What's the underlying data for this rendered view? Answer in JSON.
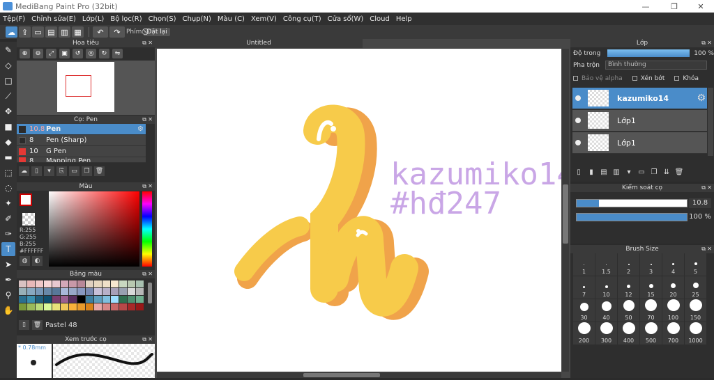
{
  "window": {
    "title": "MediBang Paint Pro (32bit)",
    "minimize": "—",
    "maximize": "❐",
    "close": "✕"
  },
  "menu": [
    "Tệp(F)",
    "Chỉnh sửa(E)",
    "Lớp(L)",
    "Bộ lọc(R)",
    "Chọn(S)",
    "Chụp(N)",
    "Màu (C)",
    "Xem(V)",
    "Công cụ(T)",
    "Cửa sổ(W)",
    "Cloud",
    "Help"
  ],
  "toolbar": {
    "shortcut_label": "Phím",
    "reset_label": "Đặt lại"
  },
  "navigator": {
    "title": "Hoa tiêu"
  },
  "brush": {
    "title": "Cọ: Pen",
    "items": [
      {
        "size": "10.8",
        "name": "Pen",
        "color": "#2b2b2b"
      },
      {
        "size": "8",
        "name": "Pen (Sharp)",
        "color": "#2b2b2b"
      },
      {
        "size": "10",
        "name": "G Pen",
        "color": "#e53935"
      },
      {
        "size": "8",
        "name": "Mapping Pen",
        "color": "#e53935"
      }
    ]
  },
  "color": {
    "title": "Màu",
    "r": "R:255",
    "g": "G:255",
    "b": "B:255",
    "hex": "#FFFFFF"
  },
  "palette": {
    "title": "Bảng màu",
    "name": "Pastel 48",
    "swatches": [
      "#d9c2c2",
      "#e8b8b8",
      "#f0c8c8",
      "#f7d6d6",
      "#e8c8d0",
      "#d4a8b8",
      "#c898a8",
      "#b88898",
      "#e0d0c0",
      "#e8d8c0",
      "#f0e0c8",
      "#f8e8d0",
      "#c8d8c0",
      "#b8c8b0",
      "#a8c0b0",
      "#98b0b8",
      "#88a8c0",
      "#7898b8",
      "#6888a8",
      "#587898",
      "#a8b8d8",
      "#98a8c8",
      "#8898c0",
      "#7888b0",
      "#c8c0d8",
      "#b8b0c8",
      "#a8a0b8",
      "#98a0b0",
      "#d8d8d8",
      "#b8b8b8",
      "#2a6f8f",
      "#3a8faf",
      "#1f5f7f",
      "#0f4f6f",
      "#7a3f6f",
      "#9a5f8f",
      "#5a2f5f",
      "#000000",
      "#3f7f9f",
      "#5f9fbf",
      "#7fbfdf",
      "#9fdfff",
      "#2f6f4f",
      "#4f8f6f",
      "#6faf8f",
      "#7a9a3a",
      "#9aba5a",
      "#bada7a",
      "#dafa9a",
      "#e8e07a",
      "#f0c85a",
      "#f8b03a",
      "#e89a2a",
      "#d8821a",
      "#e8a8a8",
      "#d88888",
      "#c86868",
      "#b84848",
      "#a82828",
      "#981818"
    ]
  },
  "preview": {
    "title": "Xem trước cọ",
    "size": "* 0.78mm"
  },
  "canvas": {
    "tab": "Untitled",
    "artwork_text_1": "kazumiko14",
    "artwork_text_2": "#hđ247"
  },
  "layer": {
    "title": "Lớp",
    "opacity_label": "Độ trong",
    "opacity_value": "100 %",
    "opacity": 1.0,
    "blend_label": "Pha trộn",
    "blend_value": "Bình thường",
    "protect_alpha": "Bảo vệ alpha",
    "clipping": "Xén bớt",
    "lock": "Khóa",
    "layers": [
      {
        "name": "kazumiko14",
        "selected": true
      },
      {
        "name": "Lớp1",
        "selected": false
      },
      {
        "name": "Lớp1",
        "selected": false
      }
    ]
  },
  "brush_control": {
    "title": "Kiểm soát cọ",
    "size_value": "10.8",
    "size_fraction": 0.2,
    "opacity_value": "100 %",
    "opacity_fraction": 1.0
  },
  "brush_size": {
    "title": "Brush Size",
    "sizes": [
      "1",
      "1.5",
      "2",
      "3",
      "4",
      "5",
      "7",
      "10",
      "12",
      "15",
      "20",
      "25",
      "30",
      "40",
      "50",
      "70",
      "100",
      "150",
      "200",
      "300",
      "400",
      "500",
      "700",
      "1000"
    ]
  }
}
